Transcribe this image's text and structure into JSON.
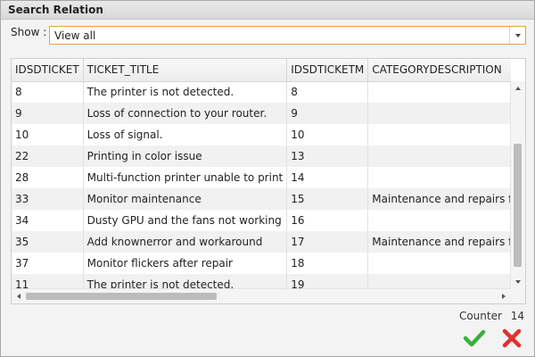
{
  "dialog": {
    "title": "Search Relation"
  },
  "filter": {
    "label": "Show :",
    "value": "View all"
  },
  "table": {
    "columns": [
      "IDSDTICKET",
      "TICKET_TITLE",
      "IDSDTICKETM",
      "CATEGORYDESCRIPTION"
    ],
    "rows": [
      [
        "8",
        "The printer is not detected.",
        "8",
        ""
      ],
      [
        "9",
        "Loss of connection to your router.",
        "9",
        ""
      ],
      [
        "10",
        "Loss of signal.",
        "10",
        ""
      ],
      [
        "22",
        "Printing in color issue",
        "13",
        ""
      ],
      [
        "28",
        "Multi-function printer unable to print",
        "14",
        ""
      ],
      [
        "33",
        "Monitor maintenance",
        "15",
        "Maintenance and repairs for"
      ],
      [
        "34",
        "Dusty GPU and the fans not working",
        "16",
        ""
      ],
      [
        "35",
        "Add knownerror and workaround",
        "17",
        "Maintenance and repairs for"
      ],
      [
        "37",
        "Monitor flickers after repair",
        "18",
        ""
      ],
      [
        "11",
        "The printer is not detected.",
        "19",
        ""
      ]
    ]
  },
  "footer": {
    "counter_label": "Counter",
    "counter_value": "14"
  },
  "colors": {
    "accent_border": "#e7a04f",
    "ok": "#3cae3c",
    "cancel": "#e03030"
  },
  "icons": {
    "ok": "checkmark-icon",
    "cancel": "close-x-icon"
  }
}
